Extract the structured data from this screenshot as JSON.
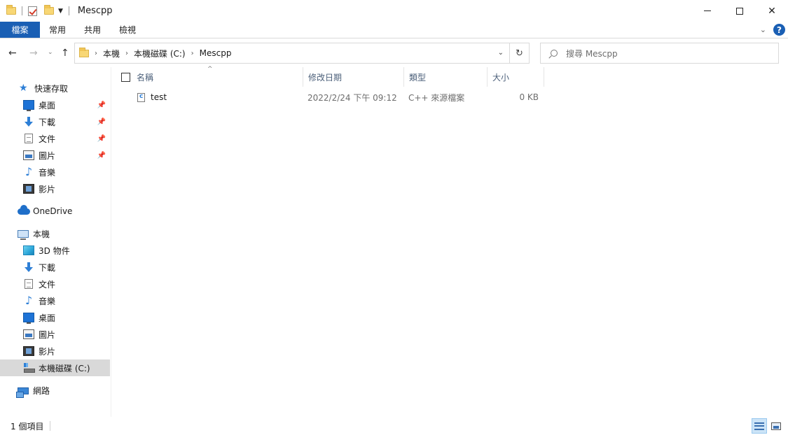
{
  "window": {
    "title": "Mescpp"
  },
  "ribbon": {
    "tabs": [
      "檔案",
      "常用",
      "共用",
      "檢視"
    ]
  },
  "address": {
    "crumbs": [
      "本機",
      "本機磁碟 (C:)",
      "Mescpp"
    ]
  },
  "search": {
    "placeholder": "搜尋 Mescpp"
  },
  "sidebar": {
    "quick_access": "快速存取",
    "quick_items": [
      "桌面",
      "下載",
      "文件",
      "圖片",
      "音樂",
      "影片"
    ],
    "onedrive": "OneDrive",
    "this_pc": "本機",
    "pc_items": [
      "3D 物件",
      "下載",
      "文件",
      "音樂",
      "桌面",
      "圖片",
      "影片",
      "本機磁碟 (C:)"
    ],
    "network": "網路"
  },
  "columns": {
    "name": "名稱",
    "date": "修改日期",
    "type": "類型",
    "size": "大小"
  },
  "files": [
    {
      "name": "test",
      "date": "2022/2/24 下午 09:12",
      "type": "C++ 來源檔案",
      "size": "0 KB"
    }
  ],
  "status": {
    "count": "1 個項目"
  },
  "colors": {
    "accent": "#1a5fb4",
    "selection": "#d9d9d9"
  }
}
